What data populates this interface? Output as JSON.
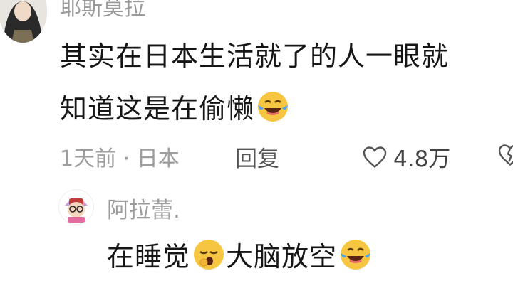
{
  "comment": {
    "username": "耶斯莫拉",
    "text_line1": "其实在日本生活就了的人一眼就",
    "text_line2": "知道这是在偷懒",
    "meta": "1天前 · 日本",
    "reply_label": "回复",
    "like_count": "4.8万",
    "icons": [
      "avatar",
      "laugh-cry-emoji",
      "heart-icon",
      "dislike-icon"
    ]
  },
  "reply": {
    "username": "阿拉蕾.",
    "text_part1": "在睡觉",
    "text_part2": "大脑放空",
    "icons": [
      "avatar",
      "yawning-emoji",
      "laugh-cry-emoji"
    ]
  },
  "colors": {
    "text": "#161616",
    "secondary": "#9e9e9e",
    "emoji_face": "#f6c542",
    "tear": "#4fa6e8"
  }
}
